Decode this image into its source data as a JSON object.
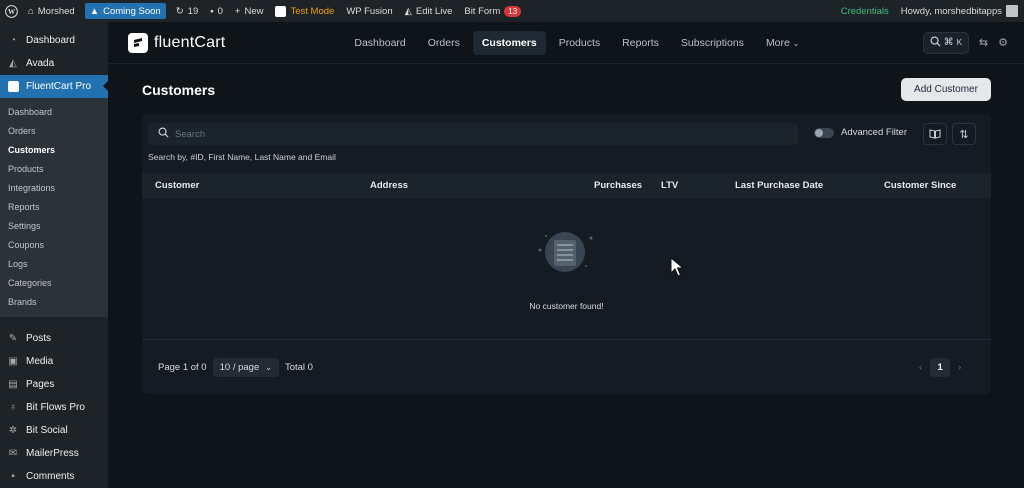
{
  "adminbar": {
    "site_name": "Morshed",
    "coming_soon": "Coming Soon",
    "updates_count": "19",
    "comments_count": "0",
    "new_label": "New",
    "test_mode": "Test Mode",
    "wp_fusion": "WP Fusion",
    "edit_live": "Edit Live",
    "bit_form": "Bit Form",
    "bit_form_badge": "13",
    "credentials": "Credentials",
    "howdy": "Howdy, morshedbitapps"
  },
  "wp_menu": {
    "top_items": [
      {
        "label": "Dashboard",
        "icon": "dashboard-icon"
      },
      {
        "label": "Avada",
        "icon": "avada-icon"
      },
      {
        "label": "FluentCart Pro",
        "icon": "fluentcart-icon"
      }
    ],
    "fluentcart_submenu": [
      "Dashboard",
      "Orders",
      "Customers",
      "Products",
      "Integrations",
      "Reports",
      "Settings",
      "Coupons",
      "Logs",
      "Categories",
      "Brands"
    ],
    "bottom_items": [
      {
        "label": "Posts",
        "icon": "pin-icon"
      },
      {
        "label": "Media",
        "icon": "media-icon"
      },
      {
        "label": "Pages",
        "icon": "pages-icon"
      },
      {
        "label": "Bit Flows Pro",
        "icon": "bitflows-icon"
      },
      {
        "label": "Bit Social",
        "icon": "bitsocial-icon"
      },
      {
        "label": "MailerPress",
        "icon": "mail-icon"
      },
      {
        "label": "Comments",
        "icon": "comment-icon"
      }
    ]
  },
  "fc_nav": {
    "logo_text": "fluentCart",
    "links": [
      "Dashboard",
      "Orders",
      "Customers",
      "Products",
      "Reports",
      "Subscriptions",
      "More"
    ],
    "active_link": "Customers",
    "shortcut_key": "K"
  },
  "page": {
    "title": "Customers",
    "add_button": "Add Customer",
    "search_placeholder": "Search",
    "search_hint": "Search by, #ID, First Name, Last Name and Email",
    "advanced_filter": "Advanced Filter",
    "columns": [
      "Customer",
      "Address",
      "Purchases",
      "LTV",
      "Last Purchase Date",
      "Customer Since"
    ],
    "empty_message": "No customer found!",
    "page_info": "Page 1 of 0",
    "per_page": "10 / page",
    "total": "Total 0",
    "current_page": "1"
  },
  "colors": {
    "background": "#0f1419",
    "card": "#141b22",
    "wp_sidebar": "#1d2327",
    "active_menu": "#2271b1",
    "test_mode": "#f59e0b",
    "credentials": "#3fbf7f"
  }
}
